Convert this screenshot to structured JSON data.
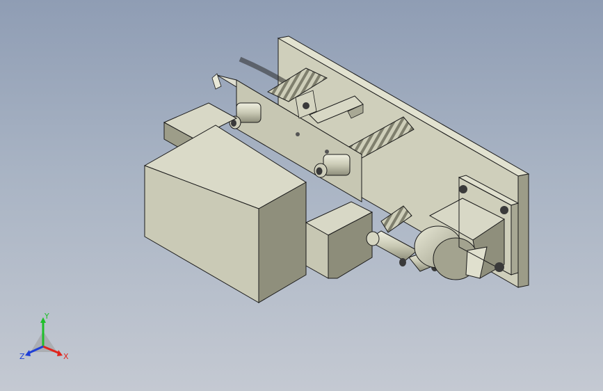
{
  "triad": {
    "x_label": "X",
    "y_label": "Y",
    "z_label": "Z",
    "x_color": "#e0241c",
    "y_color": "#1fbf2a",
    "z_color": "#1f3fd6"
  },
  "colors": {
    "background_top": "#8f9db4",
    "background_bottom": "#c4c9d2",
    "part_light": "#d6d6c2",
    "part_mid": "#b9b9a4",
    "part_dark": "#8f8f7c",
    "edge": "#1a1a1a"
  }
}
